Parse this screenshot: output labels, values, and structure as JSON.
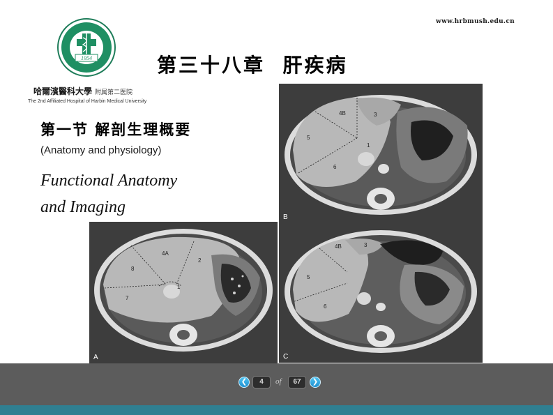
{
  "header": {
    "url": "www.hrbmush.edu.cn",
    "chapter_title": "第三十八章  肝疾病"
  },
  "logo": {
    "seal_year": "1954",
    "university_cn": "哈爾濱醫科大學",
    "hospital_cn": "附属第二医院",
    "university_en": "The 2nd Affiliated Hospital of Harbin Medical University"
  },
  "content": {
    "section_title": "第一节 解剖生理概要",
    "section_subtitle": "(Anatomy and physiology)",
    "functional_line1": "Functional Anatomy",
    "functional_line2": "and Imaging"
  },
  "figures": {
    "panel_a": {
      "label": "A",
      "segments": [
        "4A",
        "8",
        "2",
        "1",
        "7"
      ]
    },
    "panel_b": {
      "label": "B",
      "segments": [
        "4B",
        "3",
        "5",
        "1",
        "6"
      ]
    },
    "panel_c": {
      "label": "C",
      "segments": [
        "4B",
        "3",
        "5",
        "6"
      ]
    }
  },
  "navigation": {
    "current_page": "4",
    "of_label": "of",
    "total_pages": "67",
    "prev_icon": "chevron-left-icon",
    "next_icon": "chevron-right-icon"
  },
  "colors": {
    "accent": "#2f7f91",
    "nav_bar": "#5c5c5c",
    "nav_button": "#2aa6e4"
  }
}
